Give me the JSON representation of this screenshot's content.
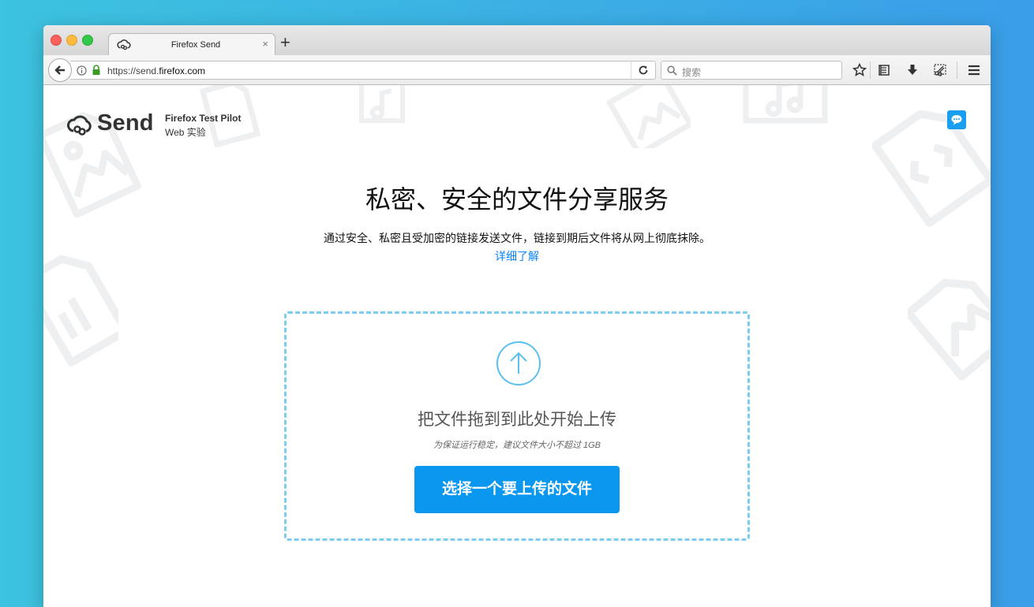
{
  "browser": {
    "tab_title": "Firefox Send",
    "tab_close": "×",
    "new_tab": "+",
    "url_prefix": "https://send.",
    "url_domain": "firefox.com",
    "search_placeholder": "搜索"
  },
  "page": {
    "logo_text": "Send",
    "pilot_label": "Firefox Test Pilot",
    "web_experiment": "Web 实验",
    "headline": "私密、安全的文件分享服务",
    "description": "通过安全、私密且受加密的链接发送文件，链接到期后文件将从网上彻底抹除。",
    "learn_more": "详细了解",
    "drop_title": "把文件拖到到此处开始上传",
    "drop_hint": "为保证运行稳定，建议文件大小不超过 1GB",
    "choose_button": "选择一个要上传的文件"
  },
  "colors": {
    "accent": "#0a97f0",
    "link": "#0a84ff",
    "dropzone_border": "#7ecdf0"
  },
  "icons": [
    "firefox-send-icon",
    "back-arrow-icon",
    "info-icon",
    "lock-icon",
    "reload-icon",
    "search-icon",
    "star-icon",
    "reader-list-icon",
    "download-icon",
    "screenshot-icon",
    "menu-icon",
    "feedback-chat-icon",
    "upload-arrow-icon"
  ]
}
